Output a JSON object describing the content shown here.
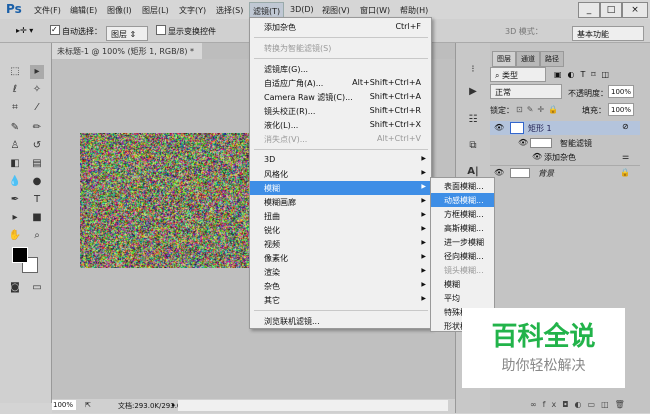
{
  "app": {
    "logo": "Ps"
  },
  "menubar": [
    "文件(F)",
    "编辑(E)",
    "图像(I)",
    "图层(L)",
    "文字(Y)",
    "选择(S)",
    "滤镜(T)",
    "3D(D)",
    "视图(V)",
    "窗口(W)",
    "帮助(H)"
  ],
  "window_controls": [
    "_",
    "□",
    "×"
  ],
  "options": {
    "auto_select_label": "自动选择：",
    "auto_select_checked": true,
    "auto_select_value": "图层",
    "show_transform_label": "显示变换控件",
    "show_transform_checked": false,
    "mode3d_label": "3D 模式：",
    "workspace": "基本功能"
  },
  "document_tab": {
    "title": "未标题-1 @ 100% (矩形 1, RGB/8) *",
    "close": "×"
  },
  "filter_menu": [
    {
      "label": "添加杂色",
      "shortcut": "Ctrl+F"
    },
    {
      "sep": true
    },
    {
      "label": "转换为智能滤镜(S)",
      "disabled": true
    },
    {
      "sep": true
    },
    {
      "label": "滤镜库(G)..."
    },
    {
      "label": "自适应广角(A)...",
      "shortcut": "Alt+Shift+Ctrl+A"
    },
    {
      "label": "Camera Raw 滤镜(C)...",
      "shortcut": "Shift+Ctrl+A"
    },
    {
      "label": "镜头校正(R)...",
      "shortcut": "Shift+Ctrl+R"
    },
    {
      "label": "液化(L)...",
      "shortcut": "Shift+Ctrl+X"
    },
    {
      "label": "消失点(V)...",
      "shortcut": "Alt+Ctrl+V",
      "disabled": true
    },
    {
      "sep": true
    },
    {
      "label": "3D",
      "submenu": true
    },
    {
      "label": "风格化",
      "submenu": true
    },
    {
      "label": "模糊",
      "submenu": true,
      "highlighted": true
    },
    {
      "label": "模糊画廊",
      "submenu": true
    },
    {
      "label": "扭曲",
      "submenu": true
    },
    {
      "label": "锐化",
      "submenu": true
    },
    {
      "label": "视频",
      "submenu": true
    },
    {
      "label": "像素化",
      "submenu": true
    },
    {
      "label": "渲染",
      "submenu": true
    },
    {
      "label": "杂色",
      "submenu": true
    },
    {
      "label": "其它",
      "submenu": true
    },
    {
      "sep": true
    },
    {
      "label": "浏览联机滤镜..."
    }
  ],
  "blur_submenu": [
    {
      "label": "表面模糊..."
    },
    {
      "label": "动感模糊...",
      "highlighted": true
    },
    {
      "label": "方框模糊..."
    },
    {
      "label": "高斯模糊..."
    },
    {
      "label": "进一步模糊"
    },
    {
      "label": "径向模糊..."
    },
    {
      "label": "镜头模糊...",
      "disabled": true
    },
    {
      "label": "模糊"
    },
    {
      "label": "平均"
    },
    {
      "label": "特殊模糊..."
    },
    {
      "label": "形状模糊..."
    }
  ],
  "layers_panel": {
    "tabs": [
      "图层",
      "通道",
      "路径"
    ],
    "filter_kind": "类型",
    "blend_mode": "正常",
    "opacity_label": "不透明度：",
    "opacity": "100%",
    "lock_label": "锁定：",
    "fill_label": "填充：",
    "fill": "100%",
    "layers": [
      {
        "name": "矩形 1",
        "selected": true
      },
      {
        "name": "智能滤镜"
      },
      {
        "name": "添加杂色"
      },
      {
        "name": "背景",
        "locked": true
      }
    ]
  },
  "status": {
    "zoom": "100%",
    "doc": "文档:293.0K/293.0K"
  },
  "watermark": {
    "title": "百科全说",
    "subtitle": "助你轻松解决"
  },
  "colors": {
    "highlight": "#3e8ee6",
    "watermark_green": "#22b34a"
  }
}
